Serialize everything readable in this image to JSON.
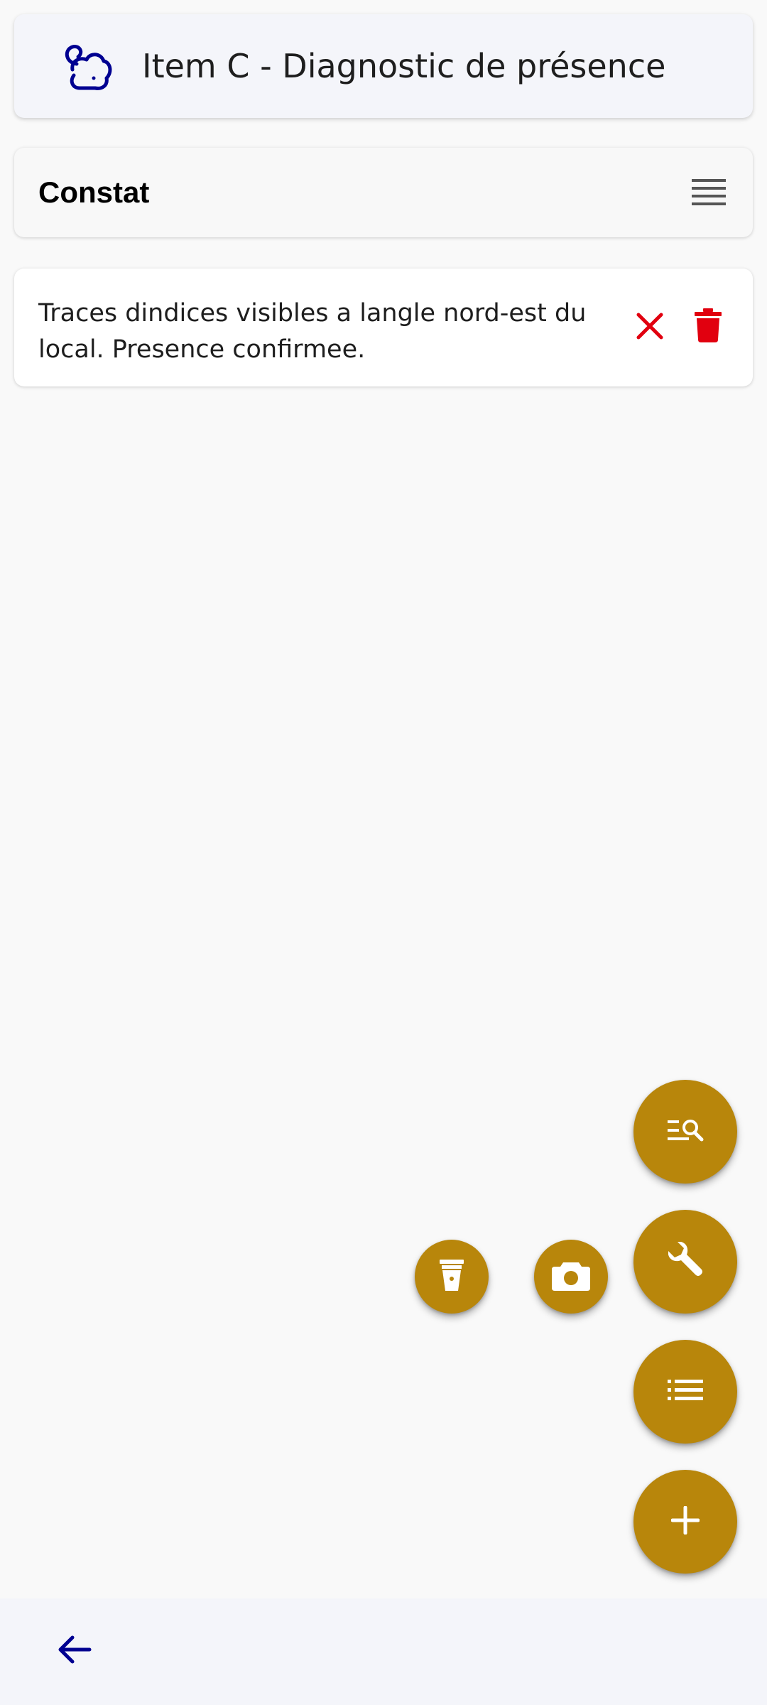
{
  "header": {
    "title": "Item C - Diagnostic de présence",
    "icon": "rodent-icon",
    "icon_color": "#000091"
  },
  "section": {
    "title": "Constat",
    "icon": "menu-lines-icon"
  },
  "observation": {
    "text": "Traces dindices visibles a langle nord-est du local. Presence confirmee.",
    "close_icon": "close-icon",
    "delete_icon": "trash-icon",
    "action_color": "#e1000f"
  },
  "fabs": {
    "color": "#b8860b",
    "items": [
      {
        "name": "search-list",
        "icon": "search-list-icon"
      },
      {
        "name": "tools",
        "icon": "wrench-icon"
      },
      {
        "name": "trap",
        "icon": "trap-icon"
      },
      {
        "name": "camera",
        "icon": "camera-icon"
      },
      {
        "name": "list",
        "icon": "list-icon"
      },
      {
        "name": "add",
        "icon": "plus-icon"
      }
    ]
  },
  "bottom_bar": {
    "back_icon": "arrow-left-icon",
    "back_color": "#000091"
  }
}
